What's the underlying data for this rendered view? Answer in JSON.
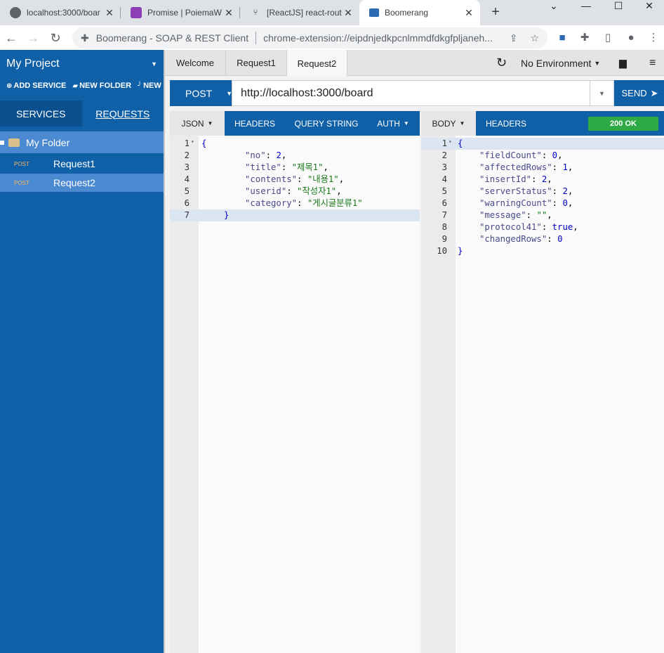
{
  "browser": {
    "tabs": [
      {
        "title": "localhost:3000/boar",
        "icon": "globe-icon"
      },
      {
        "title": "Promise | PoiemaW",
        "icon": "poiema-icon"
      },
      {
        "title": "[ReactJS] react-rout",
        "icon": "velog-icon"
      },
      {
        "title": "Boomerang",
        "icon": "boomerang-icon"
      }
    ],
    "omnibox": {
      "site": "Boomerang - SOAP & REST Client",
      "url": "chrome-extension://eipdnjedkpcnlmmdfdkgfpljaneh..."
    }
  },
  "sidebar": {
    "project": "My Project",
    "actions": [
      "ADD SERVICE",
      "NEW FOLDER",
      "NEW"
    ],
    "tabs": [
      "SERVICES",
      "REQUESTS"
    ],
    "folder": "My Folder",
    "requests": [
      {
        "method": "POST",
        "name": "Request1"
      },
      {
        "method": "POST",
        "name": "Request2"
      }
    ]
  },
  "request_tabs": [
    "Welcome",
    "Request1",
    "Request2"
  ],
  "environment": "No Environment",
  "request": {
    "method": "POST",
    "url": "http://localhost:3000/board",
    "send_label": "SEND"
  },
  "request_pane": {
    "tabs": [
      "JSON",
      "HEADERS",
      "QUERY STRING",
      "AUTH"
    ],
    "body": [
      {
        "key": "no",
        "value": "2",
        "type": "number",
        "comma": true
      },
      {
        "key": "title",
        "value": "제목1",
        "type": "string",
        "comma": true
      },
      {
        "key": "contents",
        "value": "내용1",
        "type": "string",
        "comma": true
      },
      {
        "key": "userid",
        "value": "작성자1",
        "type": "string",
        "comma": true
      },
      {
        "key": "category",
        "value": "게시글분류1",
        "type": "string",
        "comma": false
      }
    ]
  },
  "response_pane": {
    "tabs": [
      "BODY",
      "HEADERS"
    ],
    "status": "200 OK",
    "body": [
      {
        "key": "fieldCount",
        "value": "0",
        "type": "number",
        "comma": true
      },
      {
        "key": "affectedRows",
        "value": "1",
        "type": "number",
        "comma": true
      },
      {
        "key": "insertId",
        "value": "2",
        "type": "number",
        "comma": true
      },
      {
        "key": "serverStatus",
        "value": "2",
        "type": "number",
        "comma": true
      },
      {
        "key": "warningCount",
        "value": "0",
        "type": "number",
        "comma": true
      },
      {
        "key": "message",
        "value": "",
        "type": "string",
        "comma": true
      },
      {
        "key": "protocol41",
        "value": "true",
        "type": "bool",
        "comma": true
      },
      {
        "key": "changedRows",
        "value": "0",
        "type": "number",
        "comma": false
      }
    ]
  },
  "colors": {
    "brand": "#1060a8",
    "highlight": "#4b8ad0",
    "status_ok": "#2da945",
    "method_label": "#f0b463"
  }
}
